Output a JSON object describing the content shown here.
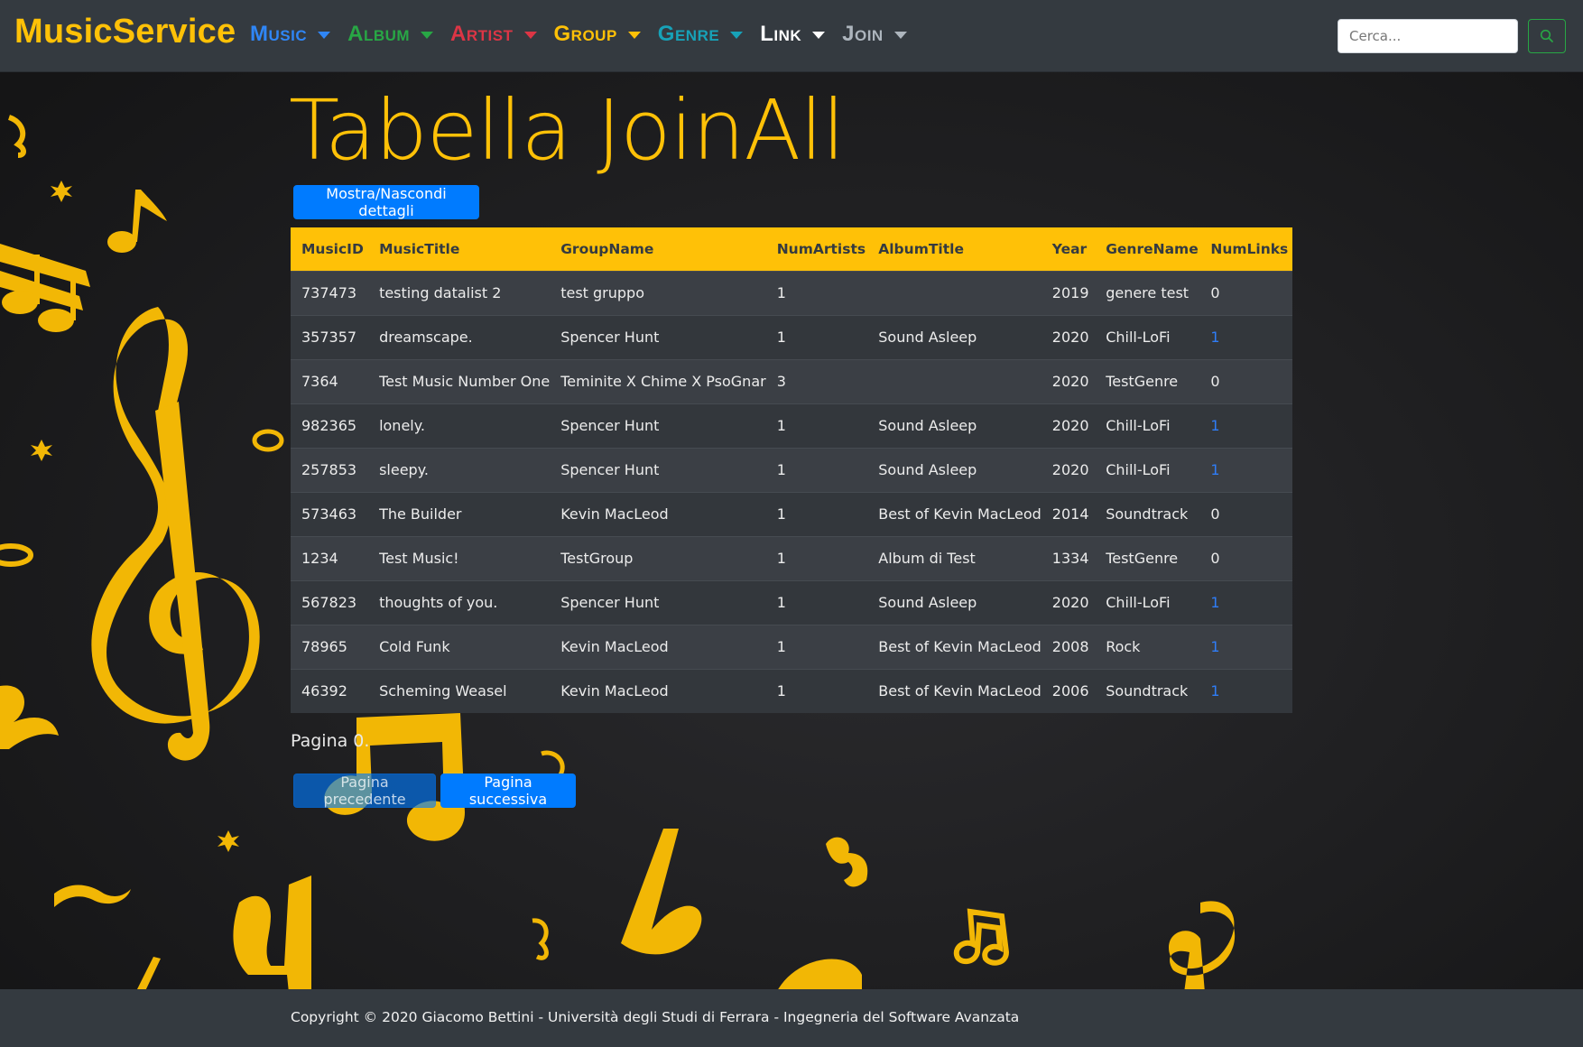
{
  "brand": "MusicService",
  "nav": [
    {
      "label": "Music",
      "color": "#2f86f6"
    },
    {
      "label": "Album",
      "color": "#28a745"
    },
    {
      "label": "Artist",
      "color": "#dc3545"
    },
    {
      "label": "Group",
      "color": "#ffc107"
    },
    {
      "label": "Genre",
      "color": "#17a2b8"
    },
    {
      "label": "Link",
      "color": "#ffffff"
    },
    {
      "label": "Join",
      "color": "#adb5bd"
    }
  ],
  "search": {
    "placeholder": "Cerca..."
  },
  "page": {
    "title": "Tabella JoinAll",
    "toggle_button": "Mostra/Nascondi dettagli"
  },
  "table": {
    "headers": [
      "MusicID",
      "MusicTitle",
      "GroupName",
      "NumArtists",
      "AlbumTitle",
      "Year",
      "GenreName",
      "NumLinks"
    ],
    "rows": [
      [
        "737473",
        "testing datalist 2",
        "test gruppo",
        "1",
        "",
        "2019",
        "genere test",
        "0"
      ],
      [
        "357357",
        "dreamscape.",
        "Spencer Hunt",
        "1",
        "Sound Asleep",
        "2020",
        "Chill-LoFi",
        "1"
      ],
      [
        "7364",
        "Test Music Number One",
        "Teminite X Chime X PsoGnar",
        "3",
        "",
        "2020",
        "TestGenre",
        "0"
      ],
      [
        "982365",
        "lonely.",
        "Spencer Hunt",
        "1",
        "Sound Asleep",
        "2020",
        "Chill-LoFi",
        "1"
      ],
      [
        "257853",
        "sleepy.",
        "Spencer Hunt",
        "1",
        "Sound Asleep",
        "2020",
        "Chill-LoFi",
        "1"
      ],
      [
        "573463",
        "The Builder",
        "Kevin MacLeod",
        "1",
        "Best of Kevin MacLeod",
        "2014",
        "Soundtrack",
        "0"
      ],
      [
        "1234",
        "Test Music!",
        "TestGroup",
        "1",
        "Album di Test",
        "1334",
        "TestGenre",
        "0"
      ],
      [
        "567823",
        "thoughts of you.",
        "Spencer Hunt",
        "1",
        "Sound Asleep",
        "2020",
        "Chill-LoFi",
        "1"
      ],
      [
        "78965",
        "Cold Funk",
        "Kevin MacLeod",
        "1",
        "Best of Kevin MacLeod",
        "2008",
        "Rock",
        "1"
      ],
      [
        "46392",
        "Scheming Weasel",
        "Kevin MacLeod",
        "1",
        "Best of Kevin MacLeod",
        "2006",
        "Soundtrack",
        "1"
      ]
    ]
  },
  "pagination": {
    "text": "Pagina 0.",
    "prev_label": "Pagina precedente",
    "next_label": "Pagina successiva"
  },
  "footer": {
    "text": "Copyright © 2020 Giacomo Bettini - Università degli Studi di Ferrara - Ingegneria del Software Avanzata"
  },
  "colors": {
    "accent": "#ffc107",
    "primary": "#007bff",
    "navbar_bg": "#343a40",
    "link_blue": "#2f7df7"
  }
}
